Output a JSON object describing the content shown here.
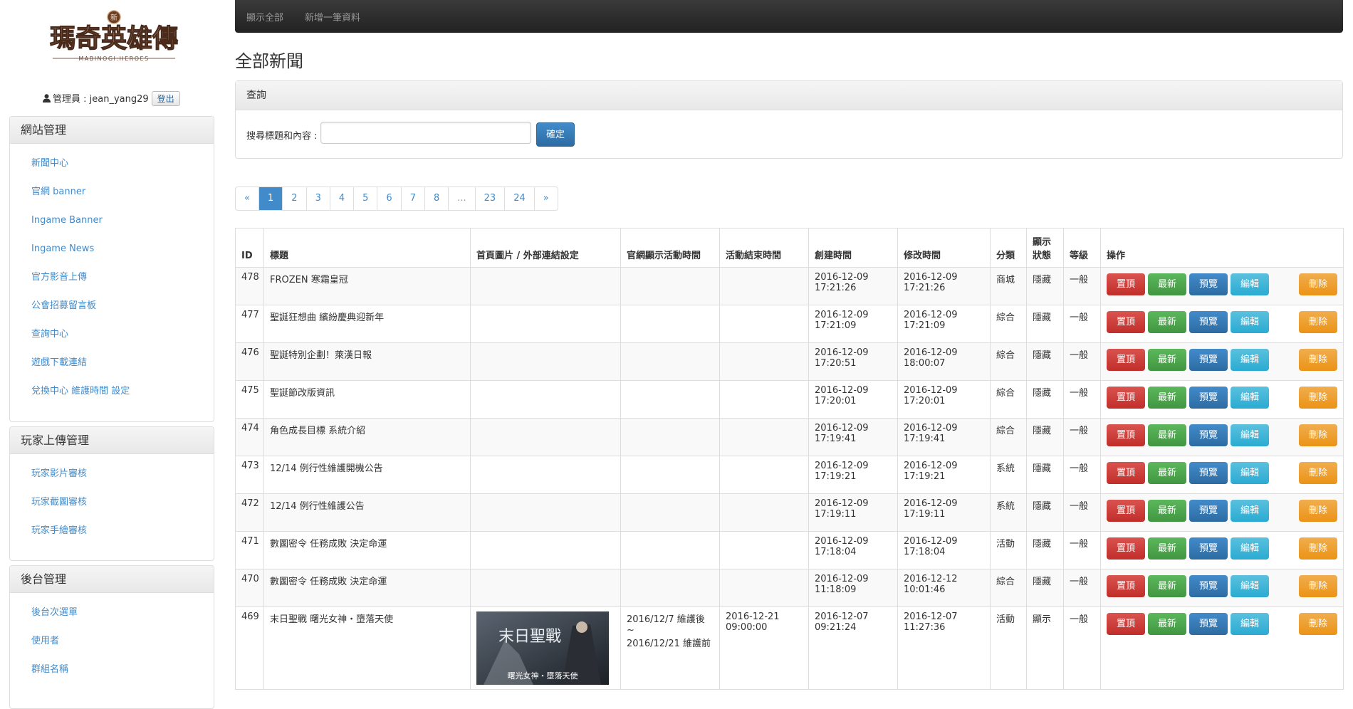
{
  "logo": {
    "text": "瑪奇英雄傳",
    "subtext": "MABINOGI:HEROES",
    "badge": "新"
  },
  "user": {
    "label": "管理員 : jean_yang29",
    "logout": "登出"
  },
  "panels": [
    {
      "title": "網站管理",
      "items": [
        "新聞中心",
        "官網 banner",
        "Ingame Banner",
        "Ingame News",
        "官方影音上傳",
        "公會招募留言板",
        "查詢中心",
        "遊戲下載連結",
        "兌換中心 維護時間 設定"
      ]
    },
    {
      "title": "玩家上傳管理",
      "items": [
        "玩家影片審核",
        "玩家截圖審核",
        "玩家手繪審核"
      ]
    },
    {
      "title": "後台管理",
      "items": [
        "後台次選單",
        "使用者",
        "群組名稱"
      ]
    }
  ],
  "navbar": {
    "show_all": "顯示全部",
    "add_new": "新增一筆資料"
  },
  "page_title": "全部新聞",
  "query": {
    "title": "查詢",
    "label": "搜尋標題和內容 :",
    "input_value": "",
    "submit": "確定"
  },
  "pagination": [
    "«",
    "1",
    "2",
    "3",
    "4",
    "5",
    "6",
    "7",
    "8",
    "...",
    "23",
    "24",
    "»"
  ],
  "pagination_active": "1",
  "table": {
    "headers": {
      "id": "ID",
      "title": "標題",
      "image": "首頁圖片 / 外部連結設定",
      "time": "官網顯示活動時間",
      "end": "活動結束時間",
      "created": "創建時間",
      "modified": "修改時間",
      "category": "分類",
      "status": "顯示\n狀態",
      "level": "等級",
      "actions": "操作"
    },
    "action_labels": {
      "top": "置頂",
      "new": "最新",
      "preview": "預覽",
      "edit": "編輯",
      "delete": "刪除"
    },
    "rows": [
      {
        "id": "478",
        "title": "FROZEN 寒霜皇冠",
        "time": "",
        "end": "",
        "created": "2016-12-09\n17:21:26",
        "modified": "2016-12-09\n17:21:26",
        "category": "商城",
        "status": "隱藏",
        "level": "一般"
      },
      {
        "id": "477",
        "title": "聖誕狂想曲 繽紛慶典迎新年",
        "time": "",
        "end": "",
        "created": "2016-12-09\n17:21:09",
        "modified": "2016-12-09\n17:21:09",
        "category": "綜合",
        "status": "隱藏",
        "level": "一般"
      },
      {
        "id": "476",
        "title": "聖誕特別企劃！萊漢日報",
        "time": "",
        "end": "",
        "created": "2016-12-09\n17:20:51",
        "modified": "2016-12-09\n18:00:07",
        "category": "綜合",
        "status": "隱藏",
        "level": "一般"
      },
      {
        "id": "475",
        "title": "聖誕節改版資訊",
        "time": "",
        "end": "",
        "created": "2016-12-09\n17:20:01",
        "modified": "2016-12-09\n17:20:01",
        "category": "綜合",
        "status": "隱藏",
        "level": "一般"
      },
      {
        "id": "474",
        "title": "角色成長目標 系統介紹",
        "time": "",
        "end": "",
        "created": "2016-12-09\n17:19:41",
        "modified": "2016-12-09\n17:19:41",
        "category": "綜合",
        "status": "隱藏",
        "level": "一般"
      },
      {
        "id": "473",
        "title": "12/14 例行性維護開機公告",
        "time": "",
        "end": "",
        "created": "2016-12-09\n17:19:21",
        "modified": "2016-12-09\n17:19:21",
        "category": "系統",
        "status": "隱藏",
        "level": "一般"
      },
      {
        "id": "472",
        "title": "12/14 例行性維護公告",
        "time": "",
        "end": "",
        "created": "2016-12-09\n17:19:11",
        "modified": "2016-12-09\n17:19:11",
        "category": "系統",
        "status": "隱藏",
        "level": "一般"
      },
      {
        "id": "471",
        "title": "數圖密令 任務成敗 決定命運",
        "time": "",
        "end": "",
        "created": "2016-12-09\n17:18:04",
        "modified": "2016-12-09\n17:18:04",
        "category": "活動",
        "status": "隱藏",
        "level": "一般"
      },
      {
        "id": "470",
        "title": "數圖密令 任務成敗 決定命運",
        "time": "",
        "end": "",
        "created": "2016-12-09\n11:18:09",
        "modified": "2016-12-12\n10:01:46",
        "category": "綜合",
        "status": "隱藏",
        "level": "一般"
      },
      {
        "id": "469",
        "title": "末日聖戰 曙光女神・墮落天使",
        "time": "2016/12/7 維護後 ~\n2016/12/21 維護前",
        "end": "2016-12-21\n09:00:00",
        "created": "2016-12-07\n09:21:24",
        "modified": "2016-12-07\n11:27:36",
        "category": "活動",
        "status": "顯示",
        "level": "一般",
        "image_title": "末日聖戰",
        "image_caption": "曙光女神・墮落天使"
      }
    ]
  }
}
